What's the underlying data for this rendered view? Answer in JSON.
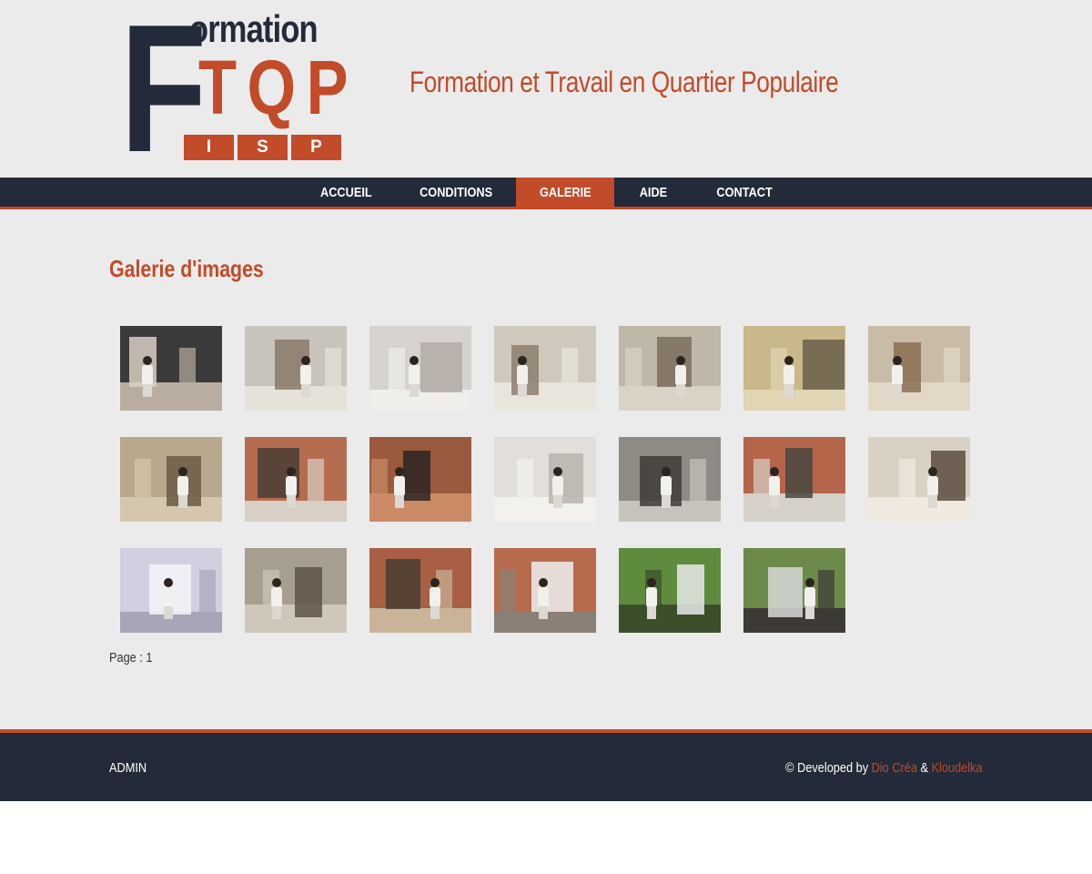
{
  "header": {
    "logo": {
      "big_letter": "F",
      "word": "ormation",
      "tqp": "TQP",
      "isp": [
        "I",
        "S",
        "P"
      ]
    },
    "tagline": "Formation et Travail en Quartier Populaire"
  },
  "nav": {
    "items": [
      {
        "label": "ACCUEIL",
        "active": false
      },
      {
        "label": "CONDITIONS",
        "active": false
      },
      {
        "label": "GALERIE",
        "active": true
      },
      {
        "label": "AIDE",
        "active": false
      },
      {
        "label": "CONTACT",
        "active": false
      }
    ]
  },
  "main": {
    "title": "Galerie d'images",
    "page_label": "Page : 1"
  },
  "gallery": {
    "rows": [
      7,
      7,
      6
    ],
    "images": [
      {
        "subject": "stone-bench-outdoor",
        "palette": [
          "#3a3a3a",
          "#d8cfc2",
          "#b8ada0"
        ]
      },
      {
        "subject": "brick-column-workshop",
        "palette": [
          "#c8c4bc",
          "#8a7a6a",
          "#e6e2da"
        ]
      },
      {
        "subject": "worker-plastering-ceiling",
        "palette": [
          "#d6d3ce",
          "#b3aca3",
          "#f0eeea"
        ]
      },
      {
        "subject": "workshop-interior",
        "palette": [
          "#cfc9bd",
          "#8e7f6d",
          "#e9e5dc"
        ]
      },
      {
        "subject": "workshop-with-ladders",
        "palette": [
          "#bfb7a8",
          "#7b6f5f",
          "#d9d3c6"
        ]
      },
      {
        "subject": "brick-structure-yellow",
        "palette": [
          "#c9b98a",
          "#6a5f4a",
          "#e0d5b4"
        ]
      },
      {
        "subject": "worker-building-wall",
        "palette": [
          "#c8bca8",
          "#8a6f52",
          "#e1d8c6"
        ]
      },
      {
        "subject": "workers-brick-corridor",
        "palette": [
          "#b8a88c",
          "#6b5a45",
          "#d5c7ad"
        ]
      },
      {
        "subject": "brick-wall-with-window",
        "palette": [
          "#b56d4f",
          "#4a3d35",
          "#d8cfc5"
        ]
      },
      {
        "subject": "brick-niche-window",
        "palette": [
          "#9a5a3e",
          "#2b2522",
          "#c98a65"
        ]
      },
      {
        "subject": "white-corridor-doors",
        "palette": [
          "#e2dfda",
          "#b9b4ac",
          "#f3f1ed"
        ]
      },
      {
        "subject": "workers-outdoor-rubble",
        "palette": [
          "#8f8b84",
          "#3f3c38",
          "#c8c3ba"
        ]
      },
      {
        "subject": "brick-kiln-outdoor",
        "palette": [
          "#b5654a",
          "#4a4640",
          "#d6d1c8"
        ]
      },
      {
        "subject": "worker-corner-wall",
        "palette": [
          "#d9d2c4",
          "#5a4e40",
          "#efe9df"
        ]
      },
      {
        "subject": "worker-plastering-wall",
        "palette": [
          "#d4cfe0",
          "#f4f4f8",
          "#a9a4b8"
        ]
      },
      {
        "subject": "brick-walls-workshop",
        "palette": [
          "#a69e8e",
          "#5e5347",
          "#cfc8ba"
        ]
      },
      {
        "subject": "brick-arch-structure",
        "palette": [
          "#a85f43",
          "#4a3d34",
          "#c9b49a"
        ]
      },
      {
        "subject": "worker-brick-wall",
        "palette": [
          "#b66b4e",
          "#eeeeee",
          "#8a8076"
        ]
      },
      {
        "subject": "workers-garden",
        "palette": [
          "#5f8b3e",
          "#e8e8e8",
          "#3b4f2a"
        ]
      },
      {
        "subject": "workers-yard",
        "palette": [
          "#6c8a4a",
          "#d8d8d8",
          "#3d3a36"
        ]
      }
    ]
  },
  "footer": {
    "admin": "ADMIN",
    "credits_prefix": "© Developed by",
    "credit_1": "Dio Créa",
    "separator": "&",
    "credit_2": "Kloudelka"
  },
  "colors": {
    "accent": "#c24b2a",
    "dark": "#232a39",
    "background": "#ebebeb"
  }
}
